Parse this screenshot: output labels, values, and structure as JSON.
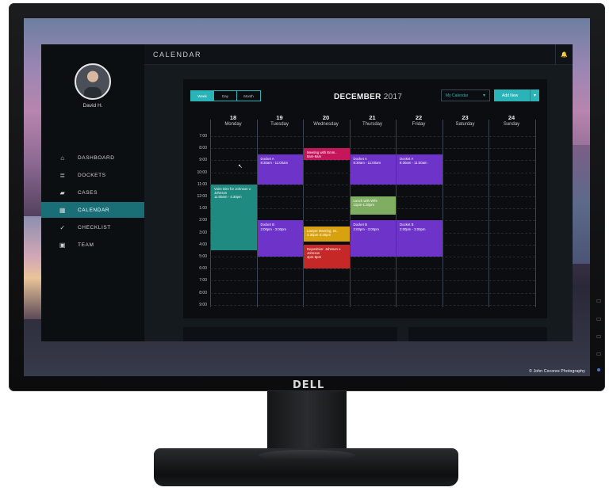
{
  "monitor": {
    "brand": "DELL",
    "photo_credit": "© John Cocores Photography"
  },
  "app": {
    "title": "CALENDAR",
    "user": {
      "name": "David H."
    },
    "nav": [
      {
        "label": "DASHBOARD",
        "icon": "home-icon",
        "glyph": "⌂"
      },
      {
        "label": "DOCKETS",
        "icon": "document-icon",
        "glyph": "≣"
      },
      {
        "label": "CASES",
        "icon": "briefcase-icon",
        "glyph": "▰"
      },
      {
        "label": "CALENDAR",
        "icon": "calendar-icon",
        "glyph": "▦",
        "active": true
      },
      {
        "label": "CHECKLIST",
        "icon": "check-circle-icon",
        "glyph": "✓"
      },
      {
        "label": "TEAM",
        "icon": "contact-icon",
        "glyph": "▣"
      }
    ],
    "bell_glyph": "🔔"
  },
  "calendar": {
    "views": [
      "Week",
      "Day",
      "Month"
    ],
    "active_view": "Week",
    "month": "DECEMBER",
    "year": "2017",
    "dropdown": "My Calendar",
    "add_button": "Add New",
    "caret": "▾",
    "days": [
      {
        "num": "18",
        "name": "Monday"
      },
      {
        "num": "19",
        "name": "Tuesday"
      },
      {
        "num": "20",
        "name": "Wednesday"
      },
      {
        "num": "21",
        "name": "Thursday"
      },
      {
        "num": "22",
        "name": "Friday"
      },
      {
        "num": "23",
        "name": "Saturday"
      },
      {
        "num": "24",
        "name": "Sunday"
      }
    ],
    "times": [
      "7:00",
      "8:00",
      "9:00",
      "10:00",
      "11:00",
      "12:00",
      "1:00",
      "2:00",
      "3:00",
      "4:00",
      "5:00",
      "6:00",
      "7:00",
      "8:00",
      "9:00"
    ],
    "events": [
      {
        "day": 0,
        "start": 4,
        "end": 9.5,
        "color": "#1f8a80",
        "title": "Voire Dire for Johnson v. Johnson",
        "time": "11:00am - 4:30pm"
      },
      {
        "day": 1,
        "start": 1.5,
        "end": 4,
        "color": "#6e33c8",
        "title": "Docket A",
        "time": "8:30am - 11:00am"
      },
      {
        "day": 1,
        "start": 7,
        "end": 10,
        "color": "#6e33c8",
        "title": "Docket B",
        "time": "2:00pm - 3:00pm"
      },
      {
        "day": 2,
        "start": 1,
        "end": 2,
        "color": "#c5165c",
        "title": "Meeting with Emm..",
        "time": "8am-9am"
      },
      {
        "day": 2,
        "start": 7.5,
        "end": 8.75,
        "color": "#d8a10f",
        "title": "Lawyer Meeting, St..",
        "time": "2:30pm-3:30pm"
      },
      {
        "day": 2,
        "start": 9,
        "end": 11,
        "color": "#c62828",
        "title": "Deposition: Johnson v. Johnson",
        "time": "4pm-6pm"
      },
      {
        "day": 3,
        "start": 1.5,
        "end": 4,
        "color": "#6e33c8",
        "title": "Docket A",
        "time": "8:30am - 11:00am"
      },
      {
        "day": 3,
        "start": 5,
        "end": 6.5,
        "color": "#7fae62",
        "title": "Lunch with Wife",
        "time": "12pm-1:30pm"
      },
      {
        "day": 3,
        "start": 7,
        "end": 10,
        "color": "#6e33c8",
        "title": "Docket B",
        "time": "2:00pm - 3:00pm"
      },
      {
        "day": 4,
        "start": 1.5,
        "end": 4,
        "color": "#6e33c8",
        "title": "Docket A",
        "time": "8:30am - 11:00am"
      },
      {
        "day": 4,
        "start": 7,
        "end": 10,
        "color": "#6e33c8",
        "title": "Docket B",
        "time": "2:00pm - 3:00pm"
      }
    ]
  }
}
